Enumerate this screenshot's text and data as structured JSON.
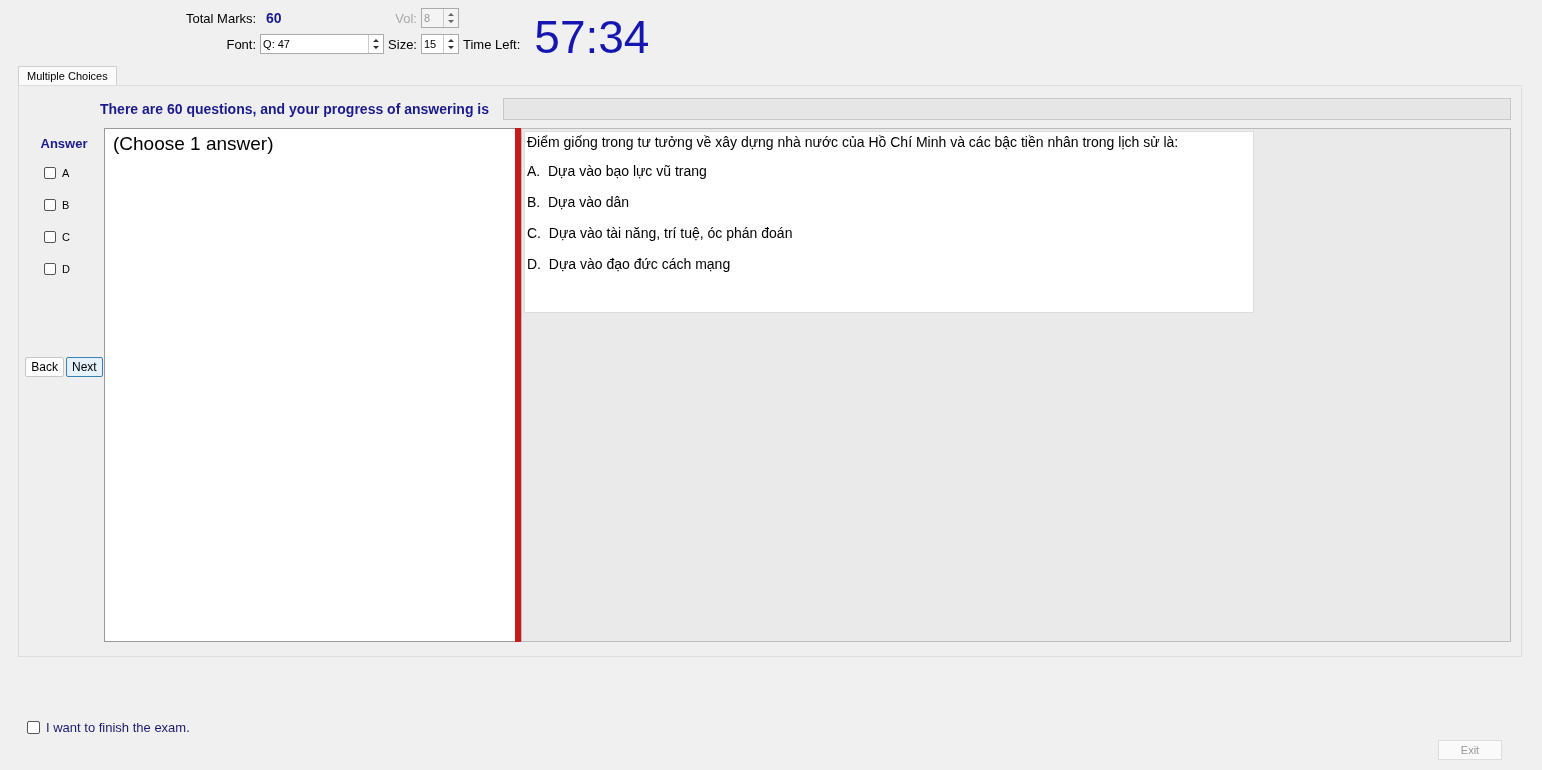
{
  "header": {
    "total_marks_label": "Total Marks:",
    "total_marks": "60",
    "vol_label": "Vol:",
    "vol": "8",
    "vol_disabled": true,
    "font_label": "Font:",
    "font_value": "Q: 47",
    "size_label": "Size:",
    "size_value": "15",
    "time_left_label": "Time Left:",
    "time_left": "57:34"
  },
  "tabs": [
    {
      "label": "Multiple Choices",
      "selected": true
    }
  ],
  "progress": {
    "text": "There are 60 questions, and your progress of answering is",
    "level": 0
  },
  "answer": {
    "heading": "Answer",
    "options": [
      {
        "label": "A",
        "checked": false
      },
      {
        "label": "B",
        "checked": false
      },
      {
        "label": "C",
        "checked": false
      },
      {
        "label": "D",
        "checked": false
      }
    ]
  },
  "nav": {
    "back": "Back",
    "next": "Next"
  },
  "instruction": "(Choose 1 answer)",
  "question": {
    "text": "Điểm giống trong tư tưởng về xây dựng nhà nước của Hồ Chí Minh và các bậc tiền nhân trong lịch sử là:",
    "options": [
      "A.  Dựa vào bạo lực vũ trang",
      "B.  Dựa vào dân",
      "C.  Dựa vào tài năng, trí tuệ, óc phán đoán",
      "D.  Dựa vào đạo đức cách mạng"
    ]
  },
  "finish": {
    "label": "I want to finish the exam.",
    "checked": false
  },
  "exit": {
    "label": "Exit",
    "disabled": true
  }
}
